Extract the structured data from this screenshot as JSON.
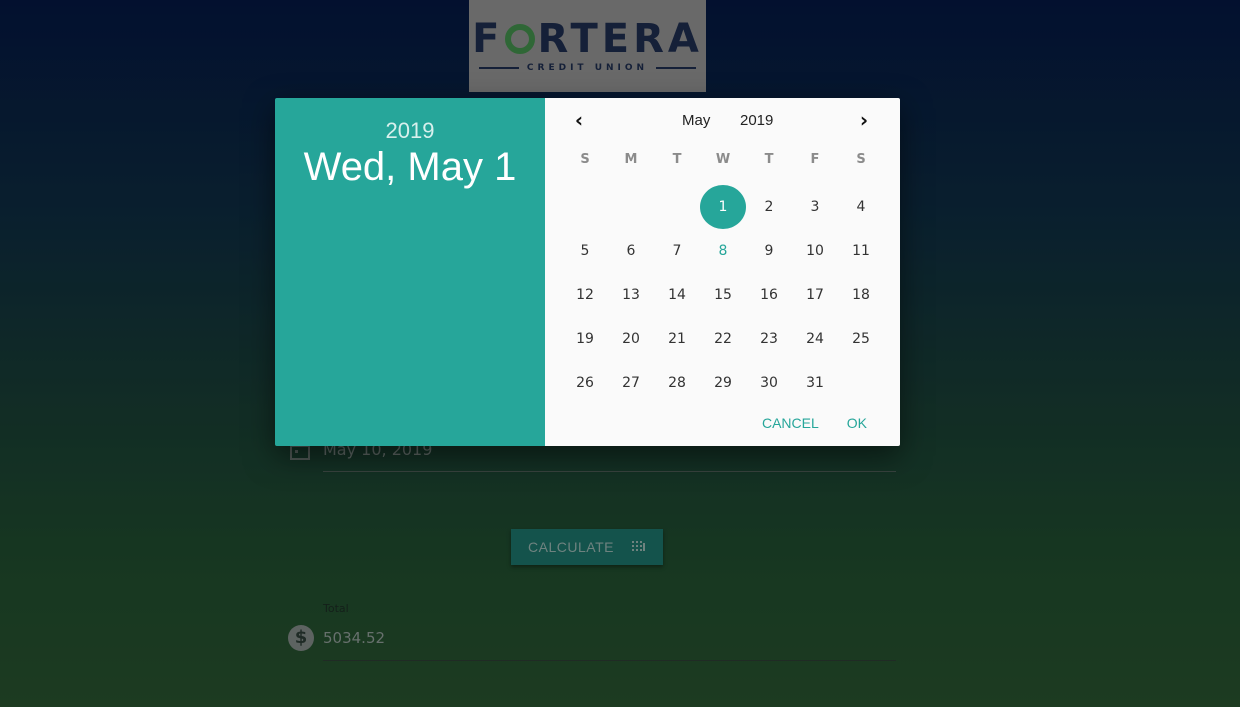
{
  "logo": {
    "brand_before": "F",
    "brand_after": "RTERA",
    "tagline": "CREDIT UNION"
  },
  "form": {
    "date_value": "May 10, 2019",
    "calculate_label": "CALCULATE",
    "total_label": "Total",
    "total_value": "5034.52"
  },
  "datepicker": {
    "header_year": "2019",
    "header_date": "Wed, May 1",
    "month": "May",
    "year": "2019",
    "prev_icon": "‹",
    "next_icon": "›",
    "weekdays": [
      "S",
      "M",
      "T",
      "W",
      "T",
      "F",
      "S"
    ],
    "weeks": [
      [
        "",
        "",
        "",
        "1",
        "2",
        "3",
        "4"
      ],
      [
        "5",
        "6",
        "7",
        "8",
        "9",
        "10",
        "11"
      ],
      [
        "12",
        "13",
        "14",
        "15",
        "16",
        "17",
        "18"
      ],
      [
        "19",
        "20",
        "21",
        "22",
        "23",
        "24",
        "25"
      ],
      [
        "26",
        "27",
        "28",
        "29",
        "30",
        "31",
        ""
      ]
    ],
    "selected_day": "1",
    "today_day": "8",
    "cancel_label": "CANCEL",
    "ok_label": "OK"
  },
  "colors": {
    "accent": "#26a69a",
    "header_bg": "#26a69a"
  },
  "icons": {
    "calendar": "calendar-icon",
    "calculator": "calculator-icon",
    "dollar": "dollar-icon"
  }
}
